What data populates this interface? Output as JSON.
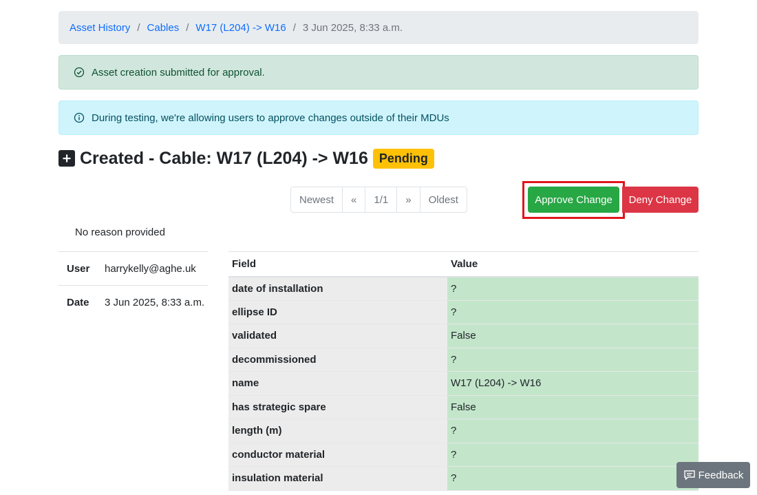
{
  "breadcrumb": {
    "items": [
      "Asset History",
      "Cables",
      "W17 (L204) -> W16"
    ],
    "separator": "/",
    "active": "3 Jun 2025, 8:33 a.m."
  },
  "alerts": {
    "success": "Asset creation submitted for approval.",
    "info": "During testing, we're allowing users to approve changes outside of their MDUs"
  },
  "heading": {
    "icon": "plus-square-icon",
    "title": "Created - Cable: W17 (L204) -> W16",
    "badge": "Pending"
  },
  "pagination": {
    "newest": "Newest",
    "prev": "«",
    "page": "1/1",
    "next": "»",
    "oldest": "Oldest"
  },
  "actions": {
    "approve": "Approve Change",
    "deny": "Deny Change"
  },
  "reason": "No reason provided",
  "meta": {
    "user_label": "User",
    "user_value": "harrykelly@aghe.uk",
    "date_label": "Date",
    "date_value": "3 Jun 2025, 8:33 a.m."
  },
  "table": {
    "headers": [
      "Field",
      "Value"
    ],
    "rows": [
      {
        "field": "date of installation",
        "value": "?"
      },
      {
        "field": "ellipse ID",
        "value": "?"
      },
      {
        "field": "validated",
        "value": "False"
      },
      {
        "field": "decommissioned",
        "value": "?"
      },
      {
        "field": "name",
        "value": "W17 (L204) -> W16"
      },
      {
        "field": "has strategic spare",
        "value": "False"
      },
      {
        "field": "length (m)",
        "value": "?"
      },
      {
        "field": "conductor material",
        "value": "?"
      },
      {
        "field": "insulation material",
        "value": "?"
      }
    ]
  },
  "feedback": "Feedback",
  "colors": {
    "approve": "#28a745",
    "deny": "#dc3545",
    "badge": "#ffc107",
    "highlight_outline": "#e0161c",
    "value_cell": "#c3e6cb"
  }
}
